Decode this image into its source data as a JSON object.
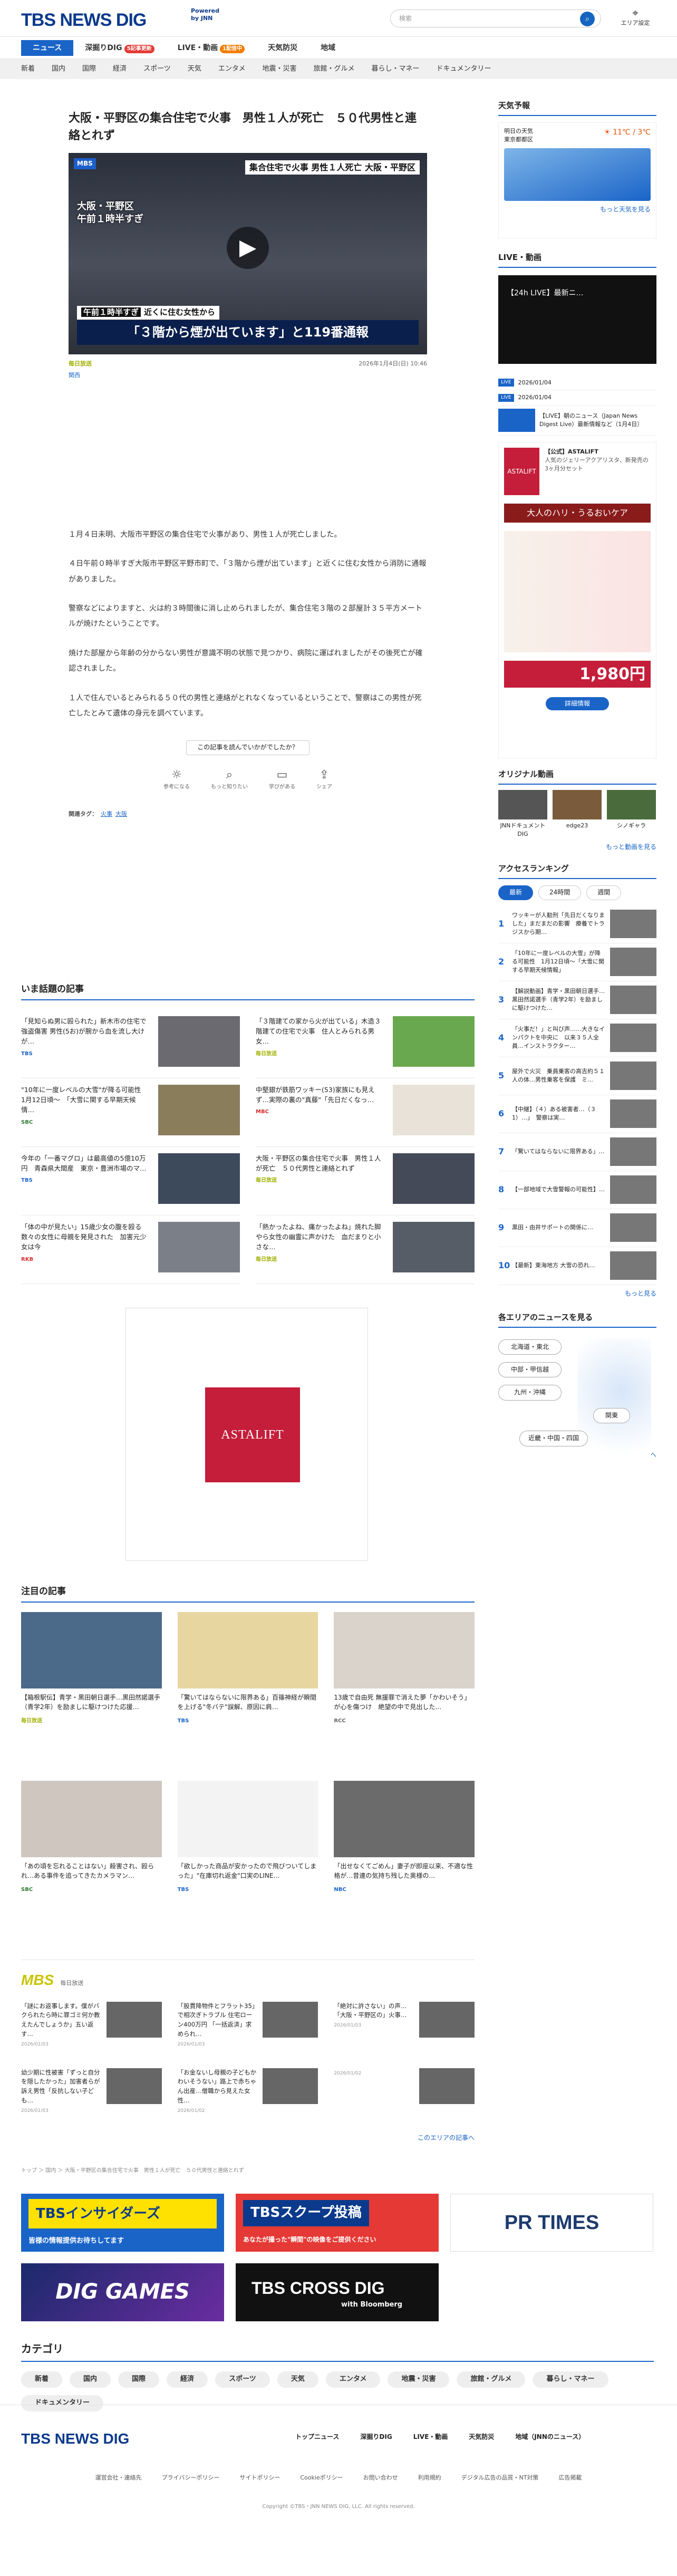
{
  "header": {
    "logo": "TBS NEWS DIG",
    "powered": "Powered\nby JNN",
    "search_placeholder": "検索",
    "area_setting": "エリア設定"
  },
  "tabs": [
    {
      "label": "ニュース",
      "active": true
    },
    {
      "label": "深掘りDIG",
      "badge": "5記事更新"
    },
    {
      "label": "LIVE・動画",
      "badge": "1配信中"
    },
    {
      "label": "天気防災"
    },
    {
      "label": "地域"
    }
  ],
  "subnav": [
    "新着",
    "国内",
    "国際",
    "経済",
    "スポーツ",
    "天気",
    "エンタメ",
    "地震・災害",
    "旅館・グルメ",
    "暮らし・マネー",
    "ドキュメンタリー"
  ],
  "article": {
    "title": "大阪・平野区の集合住宅で火事　男性１人が死亡　５０代男性と連絡とれず",
    "hero": {
      "mbs": "MBS",
      "caption_top": "集合住宅で火事 男性１人死亡 大阪・平野区",
      "caption_top_hl": "死亡",
      "loc": "大阪・平野区\n午前１時半すぎ",
      "caption_mid": "近くに住む女性から",
      "caption_mid_tag": "午前１時半すぎ",
      "caption_bottom": "「３階から煙が出ています」と119番通報"
    },
    "source": "毎日放送",
    "datetime": "2026年1月4日(日) 10:46",
    "region": "関西",
    "paragraphs": [
      "１月４日未明、大阪市平野区の集合住宅で火事があり、男性１人が死亡しました。",
      "４日午前０時半すぎ大阪市平野区平野市町で、「３階から煙が出ています」と近くに住む女性から消防に通報がありました。",
      "警察などによりますと、火は約３時間後に消し止められましたが、集合住宅３階の２部屋計３５平方メートルが焼けたということです。",
      "焼けた部屋から年齢の分からない男性が意識不明の状態で見つかり、病院に運ばれましたがその後死亡が確認されました。",
      "１人で住んでいるとみられる５０代の男性と連絡がとれなくなっているということで、警察はこの男性が死亡したとみて遺体の身元を調べています。"
    ],
    "feedback_q": "この記事を読んでいかがでしたか？",
    "reactions": [
      "参考になる",
      "もっと知りたい",
      "学びがある",
      "シェア"
    ],
    "related_label": "関連タグ：",
    "related_tags": [
      "火事",
      "大阪"
    ]
  },
  "popular": {
    "title": "いま話題の記事",
    "items": [
      {
        "text": "「見知らぬ男に殴られた」新木市の住宅で強盗傷害 男性(5お)が腕から血を流し大けが…",
        "src": "TBS"
      },
      {
        "text": "「３階建ての家から火が出ている」木造３階建ての住宅で火事　住人とみられる男女…",
        "src": "毎日放送"
      },
      {
        "text": "\"10年に一度レベルの大雪\"が降る可能性　1月12日頃〜　「大雪に関する早期天候情…",
        "src": "SBC"
      },
      {
        "text": "中堅銀が鉄筋ワッキー(53)家族にも見えず…実際の裏の\"真藤\"「先日だくなっ…",
        "src": "MBC"
      },
      {
        "text": "今年の「一番マグロ」は最高値の5億10万円　青森県大間産　東京・豊洲市場のマ…",
        "src": "TBS"
      },
      {
        "text": "大阪・平野区の集合住宅で火事　男性１人が死亡　５０代男性と連絡とれず",
        "src": "毎日放送"
      },
      {
        "text": "「体の中が見たい」15歳少女の腹を殴る　数々の女性に母親を発見された　加害元少女は今",
        "src": "RKB"
      },
      {
        "text": "「熱かったよね、痛かったよね」焼れた脚やら女性の幽霊に声かけた　血だまりと小さな…",
        "src": "毎日放送"
      }
    ]
  },
  "ad": {
    "brand": "ASTALIFT"
  },
  "attention": {
    "title": "注目の記事",
    "items": [
      {
        "text": "【箱根駅伝】青学・黒田朝日選手…黒田然諾選手（青学2年）を励ましに駆けつけた応援…",
        "src": "毎日放送"
      },
      {
        "text": "「驚いてはならないに限界ある」百篠神経が瞬間を上げる\"冬バテ\"誤解、原因に肩…",
        "src": "TBS"
      },
      {
        "text": "13歳で自由死 無援罪で消えた夢「かわいそう」が心を傷つけ　絶望の中で見出した…",
        "src": "RCC"
      },
      {
        "text": "「あの頃を忘れることはない」殺害され、殴られ…ある事件を追ってきたカメラマン…",
        "src": "SBC"
      },
      {
        "text": "「欲しかった商品が安かったので飛びついてしまった」\"在庫切れ返金\"口実のLINE…",
        "src": "TBS"
      },
      {
        "text": "「出せなくてごめん」妻子が即座以来、不適な性格が…昔連の気持ち残した奥様の…",
        "src": "NBC"
      }
    ]
  },
  "mbs": {
    "logo": "MBS",
    "label": "毎日放送",
    "items": [
      {
        "text": "「謎にお返事します。僕がバクられたら時に罪ゴミ何か教えたんでしょうか」五い返す…",
        "date": "2026/01/03"
      },
      {
        "text": "「股貫降物件とフラット35」で相次ぎトラブル 住宅ローン400万円 「一括返済」求められ…",
        "date": "2026/01/03"
      },
      {
        "text": "「絶対に許さない」の声…「大阪・平野区の」火事…",
        "date": "2026/01/03"
      },
      {
        "text": "幼少期に性被害「ずっと自分を隠したかった」加害者らが訴え男性「反抗しない子ども…",
        "date": "2026/01/03"
      },
      {
        "text": "「お金ないし母親の子どもかわいそうない」路上で赤ちゃん出産…僧職から見えた女性…",
        "date": "2026/01/02"
      },
      {
        "text": "",
        "date": "2026/01/02"
      }
    ],
    "more": "このエリアの記事へ"
  },
  "breadcrumb": "トップ ＞ 国内 ＞ 大阪・平野区の集合住宅で火事　男性１人が死亡　５０代男性と連絡とれず",
  "banners": [
    {
      "name": "TBSインサイダーズ",
      "sub": "皆様の情報提供お待ちしてます"
    },
    {
      "name": "TBSスクープ投稿",
      "sub": "あなたが撮った\"瞬間\"の映像をご提供ください"
    },
    {
      "name": "PR TIMES"
    },
    {
      "name": "DIG GAMES"
    },
    {
      "name": "TBS CROSS DIG",
      "sub": "with Bloomberg"
    }
  ],
  "categories": {
    "title": "カテゴリ",
    "items": [
      "新着",
      "国内",
      "国際",
      "経済",
      "スポーツ",
      "天気",
      "エンタメ",
      "地震・災害",
      "旅館・グルメ",
      "暮らし・マネー",
      "ドキュメンタリー"
    ]
  },
  "right": {
    "weather": {
      "title": "天気予報",
      "loc1": "明日の天気",
      "loc2": "東京都都区",
      "temp": "11℃ / 3℃",
      "more": "もっと天気を見る"
    },
    "live": {
      "title": "LIVE・動画",
      "label": "【24h LIVE】最新ニ…"
    },
    "schedule": [
      {
        "badge": "LIVE",
        "time": "2026/01/04"
      },
      {
        "badge": "LIVE",
        "time": "2026/01/04"
      },
      {
        "text": "【LIVE】朝のニュース（Japan News Digest Live）最新情報など（1月4日）"
      }
    ],
    "ad": {
      "brand": "ASTALIFT",
      "headline": "【公式】ASTALIFT",
      "desc": "人気のジェリーアクアリスタ、新発売の3ヶ月分セット",
      "copy": "大人のハリ・うるおいケア",
      "price": "1,980円",
      "cta": "詳細情報"
    },
    "originals": {
      "title": "オリジナル動画",
      "items": [
        "JNNドキュメントDIG",
        "edge23",
        "シノギャラ"
      ]
    },
    "more_video": "もっと動画を見る",
    "ranking": {
      "title": "アクセスランキング",
      "tabs": [
        "最新",
        "24時間",
        "週間"
      ],
      "items": [
        "ワッキーが人勧刑「先日だくなりました」まだまだの影響　療養でトラジスから期…",
        "「10年に一度レベルの大雪」が降る可能性　1月12日頃〜「大雪に関する早期天候情報」",
        "【解説動画】青学・黒田朝日選手…黒田然諾選手（青学2年）を励ましに駆けつけた…",
        "「火事だ！」と叫び声……大きなインパクトを中央に　以来３５人全員…インストラクター…",
        "屋外で火災　乗員乗客の高吉約５１人の体…男性乗客を保護　ミ…",
        "【中継】（４）ある被害者…（３1）…」　警察は実…",
        "「驚いてはならないに限界ある」…",
        "【一部地域で大雪警報の可能性】…",
        "黒田・由井サポートの関係に…",
        "【最新】東海地方 大雪の恐れ…"
      ],
      "more": "もっと見る"
    },
    "areas": {
      "title": "各エリアのニュースを見る",
      "btns": [
        "北海道・東北",
        "中部・甲信越",
        "九州・沖縄",
        "関東",
        "近畿・中国・四国"
      ],
      "more": "エリア一覧へ"
    }
  },
  "footer": {
    "logo": "TBS NEWS DIG",
    "nav": [
      "トップニュース",
      "深掘りDIG",
      "LIVE・動画",
      "天気防災",
      "地域（JNNのニュース）"
    ],
    "links": [
      "運営会社・連絡先",
      "プライバシーポリシー",
      "サイトポリシー",
      "Cookieポリシー",
      "お問い合わせ",
      "利用規約",
      "デジタル広告の品質・NT対策",
      "広告掲載"
    ],
    "copyright": "Copyright ©TBS・JNN NEWS DIG, LLC. All rights reserved."
  }
}
